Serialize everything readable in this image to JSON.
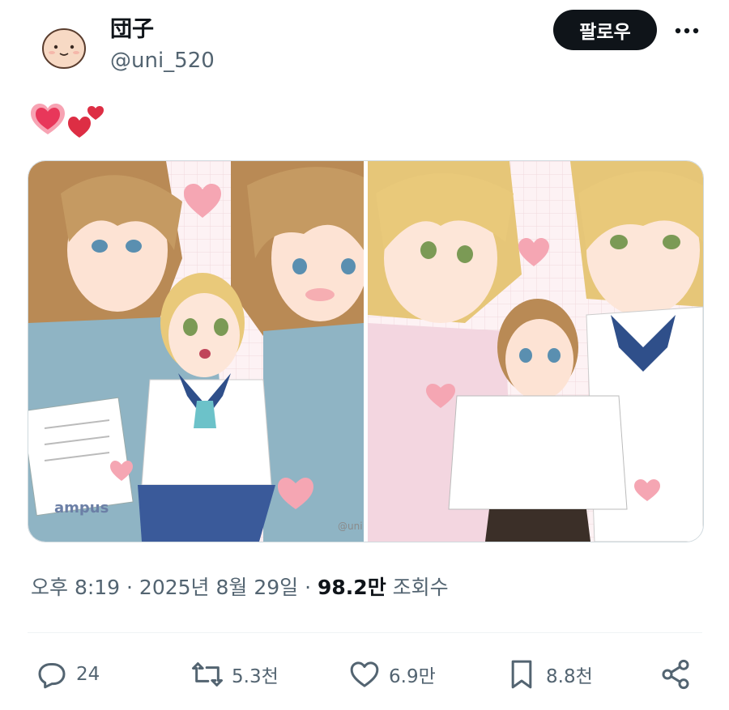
{
  "user": {
    "display_name": "団子",
    "handle": "@uni_520",
    "avatar_icon": "dango-face-avatar"
  },
  "follow_label": "팔로우",
  "more_icon": "more-dots-icon",
  "post": {
    "emoji_icons": [
      "pink-heart-emoji",
      "two-hearts-emoji"
    ],
    "media": {
      "left_watermark": "@uni",
      "left_notebook_brand": "ampus"
    }
  },
  "meta": {
    "timestamp": "오후 8:19 · 2025년 8월 29일 · ",
    "views_number": "98.2만",
    "views_label": " 조회수"
  },
  "actions": {
    "reply": {
      "icon": "reply-icon",
      "count": "24"
    },
    "repost": {
      "icon": "repost-icon",
      "count": "5.3천"
    },
    "like": {
      "icon": "heart-icon",
      "count": "6.9만"
    },
    "bookmark": {
      "icon": "bookmark-icon",
      "count": "8.8천"
    },
    "share": {
      "icon": "share-icon"
    }
  },
  "colors": {
    "text_primary": "#0f1419",
    "text_secondary": "#536471",
    "follow_button_bg": "#0f1419",
    "heart_pink": "#e8375a"
  }
}
